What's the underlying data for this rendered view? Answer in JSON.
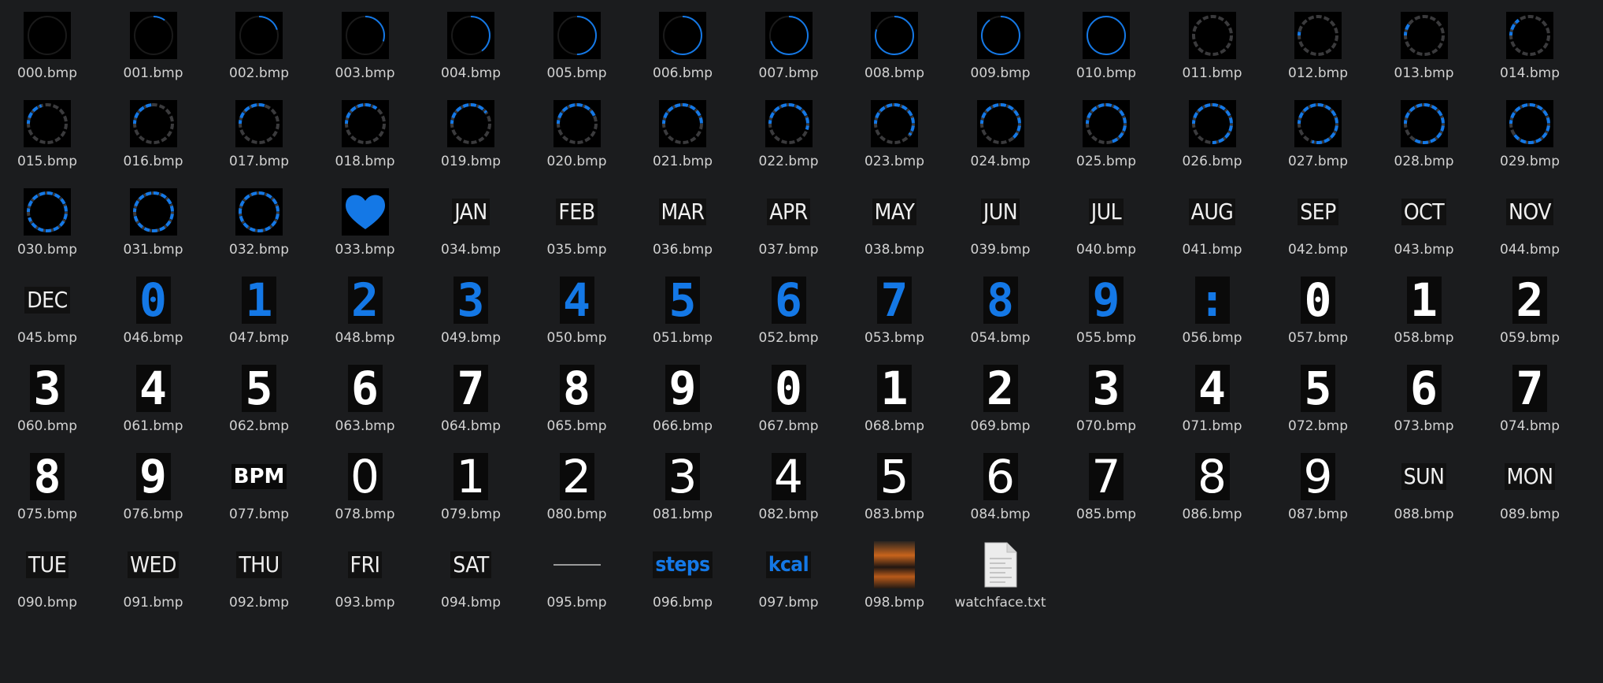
{
  "colors": {
    "background": "#1b1c1e",
    "label_text": "#d2d2d2",
    "accent_blue": "#1478e6",
    "ring_grey": "#3a3a3c",
    "thumb_black": "#0a0a0a"
  },
  "files": [
    {
      "name": "000.bmp",
      "kind": "ring",
      "style": "thin",
      "progress": 0
    },
    {
      "name": "001.bmp",
      "kind": "ring",
      "style": "thin",
      "progress": 0.1
    },
    {
      "name": "002.bmp",
      "kind": "ring",
      "style": "thin",
      "progress": 0.2
    },
    {
      "name": "003.bmp",
      "kind": "ring",
      "style": "thin",
      "progress": 0.3
    },
    {
      "name": "004.bmp",
      "kind": "ring",
      "style": "thin",
      "progress": 0.4
    },
    {
      "name": "005.bmp",
      "kind": "ring",
      "style": "thin",
      "progress": 0.5
    },
    {
      "name": "006.bmp",
      "kind": "ring",
      "style": "thin",
      "progress": 0.6
    },
    {
      "name": "007.bmp",
      "kind": "ring",
      "style": "thin",
      "progress": 0.7
    },
    {
      "name": "008.bmp",
      "kind": "ring",
      "style": "thin",
      "progress": 0.8
    },
    {
      "name": "009.bmp",
      "kind": "ring",
      "style": "thin",
      "progress": 0.9
    },
    {
      "name": "010.bmp",
      "kind": "ring",
      "style": "thin",
      "progress": 1
    },
    {
      "name": "011.bmp",
      "kind": "ring",
      "style": "dashed",
      "progress": 0
    },
    {
      "name": "012.bmp",
      "kind": "ring",
      "style": "dashed",
      "progress": 0.05
    },
    {
      "name": "013.bmp",
      "kind": "ring",
      "style": "dashed",
      "progress": 0.1
    },
    {
      "name": "014.bmp",
      "kind": "ring",
      "style": "dashed",
      "progress": 0.15
    },
    {
      "name": "015.bmp",
      "kind": "ring",
      "style": "dashed",
      "progress": 0.2
    },
    {
      "name": "016.bmp",
      "kind": "ring",
      "style": "dashed",
      "progress": 0.25
    },
    {
      "name": "017.bmp",
      "kind": "ring",
      "style": "dashed",
      "progress": 0.3
    },
    {
      "name": "018.bmp",
      "kind": "ring",
      "style": "dashed",
      "progress": 0.35
    },
    {
      "name": "019.bmp",
      "kind": "ring",
      "style": "dashed",
      "progress": 0.4
    },
    {
      "name": "020.bmp",
      "kind": "ring",
      "style": "dashed",
      "progress": 0.45
    },
    {
      "name": "021.bmp",
      "kind": "ring",
      "style": "dashed",
      "progress": 0.5
    },
    {
      "name": "022.bmp",
      "kind": "ring",
      "style": "dashed",
      "progress": 0.55
    },
    {
      "name": "023.bmp",
      "kind": "ring",
      "style": "dashed",
      "progress": 0.6
    },
    {
      "name": "024.bmp",
      "kind": "ring",
      "style": "dashed",
      "progress": 0.65
    },
    {
      "name": "025.bmp",
      "kind": "ring",
      "style": "dashed",
      "progress": 0.7
    },
    {
      "name": "026.bmp",
      "kind": "ring",
      "style": "dashed",
      "progress": 0.75
    },
    {
      "name": "027.bmp",
      "kind": "ring",
      "style": "dashed",
      "progress": 0.8
    },
    {
      "name": "028.bmp",
      "kind": "ring",
      "style": "dashed",
      "progress": 0.85
    },
    {
      "name": "029.bmp",
      "kind": "ring",
      "style": "dashed",
      "progress": 0.9
    },
    {
      "name": "030.bmp",
      "kind": "ring",
      "style": "dashed",
      "progress": 0.95
    },
    {
      "name": "031.bmp",
      "kind": "ring",
      "style": "dashed",
      "progress": 0.97
    },
    {
      "name": "032.bmp",
      "kind": "ring",
      "style": "dashed",
      "progress": 1
    },
    {
      "name": "033.bmp",
      "kind": "heart"
    },
    {
      "name": "034.bmp",
      "kind": "word",
      "text": "JAN"
    },
    {
      "name": "035.bmp",
      "kind": "word",
      "text": "FEB"
    },
    {
      "name": "036.bmp",
      "kind": "word",
      "text": "MAR"
    },
    {
      "name": "037.bmp",
      "kind": "word",
      "text": "APR"
    },
    {
      "name": "038.bmp",
      "kind": "word",
      "text": "MAY"
    },
    {
      "name": "039.bmp",
      "kind": "word",
      "text": "JUN"
    },
    {
      "name": "040.bmp",
      "kind": "word",
      "text": "JUL"
    },
    {
      "name": "041.bmp",
      "kind": "word",
      "text": "AUG"
    },
    {
      "name": "042.bmp",
      "kind": "word",
      "text": "SEP"
    },
    {
      "name": "043.bmp",
      "kind": "word",
      "text": "OCT"
    },
    {
      "name": "044.bmp",
      "kind": "word",
      "text": "NOV"
    },
    {
      "name": "045.bmp",
      "kind": "word",
      "text": "DEC"
    },
    {
      "name": "046.bmp",
      "kind": "digit",
      "style": "blue",
      "text": "0"
    },
    {
      "name": "047.bmp",
      "kind": "digit",
      "style": "blue",
      "text": "1"
    },
    {
      "name": "048.bmp",
      "kind": "digit",
      "style": "blue",
      "text": "2"
    },
    {
      "name": "049.bmp",
      "kind": "digit",
      "style": "blue",
      "text": "3"
    },
    {
      "name": "050.bmp",
      "kind": "digit",
      "style": "blue",
      "text": "4"
    },
    {
      "name": "051.bmp",
      "kind": "digit",
      "style": "blue",
      "text": "5"
    },
    {
      "name": "052.bmp",
      "kind": "digit",
      "style": "blue",
      "text": "6"
    },
    {
      "name": "053.bmp",
      "kind": "digit",
      "style": "blue",
      "text": "7"
    },
    {
      "name": "054.bmp",
      "kind": "digit",
      "style": "blue",
      "text": "8"
    },
    {
      "name": "055.bmp",
      "kind": "digit",
      "style": "blue",
      "text": "9"
    },
    {
      "name": "056.bmp",
      "kind": "digit",
      "style": "blue",
      "text": ":"
    },
    {
      "name": "057.bmp",
      "kind": "digit",
      "style": "bold",
      "text": "0"
    },
    {
      "name": "058.bmp",
      "kind": "digit",
      "style": "bold",
      "text": "1"
    },
    {
      "name": "059.bmp",
      "kind": "digit",
      "style": "bold",
      "text": "2"
    },
    {
      "name": "060.bmp",
      "kind": "digit",
      "style": "bold",
      "text": "3"
    },
    {
      "name": "061.bmp",
      "kind": "digit",
      "style": "bold",
      "text": "4"
    },
    {
      "name": "062.bmp",
      "kind": "digit",
      "style": "bold",
      "text": "5"
    },
    {
      "name": "063.bmp",
      "kind": "digit",
      "style": "bold",
      "text": "6"
    },
    {
      "name": "064.bmp",
      "kind": "digit",
      "style": "bold",
      "text": "7"
    },
    {
      "name": "065.bmp",
      "kind": "digit",
      "style": "bold",
      "text": "8"
    },
    {
      "name": "066.bmp",
      "kind": "digit",
      "style": "bold",
      "text": "9"
    },
    {
      "name": "067.bmp",
      "kind": "digit",
      "style": "bold",
      "text": "0"
    },
    {
      "name": "068.bmp",
      "kind": "digit",
      "style": "bold",
      "text": "1"
    },
    {
      "name": "069.bmp",
      "kind": "digit",
      "style": "bold",
      "text": "2"
    },
    {
      "name": "070.bmp",
      "kind": "digit",
      "style": "bold",
      "text": "3"
    },
    {
      "name": "071.bmp",
      "kind": "digit",
      "style": "bold",
      "text": "4"
    },
    {
      "name": "072.bmp",
      "kind": "digit",
      "style": "bold",
      "text": "5"
    },
    {
      "name": "073.bmp",
      "kind": "digit",
      "style": "bold",
      "text": "6"
    },
    {
      "name": "074.bmp",
      "kind": "digit",
      "style": "bold",
      "text": "7"
    },
    {
      "name": "075.bmp",
      "kind": "digit",
      "style": "bold",
      "text": "8"
    },
    {
      "name": "076.bmp",
      "kind": "digit",
      "style": "bold",
      "text": "9"
    },
    {
      "name": "077.bmp",
      "kind": "bpm",
      "text": "BPM"
    },
    {
      "name": "078.bmp",
      "kind": "digit",
      "style": "thin",
      "text": "0"
    },
    {
      "name": "079.bmp",
      "kind": "digit",
      "style": "thin",
      "text": "1"
    },
    {
      "name": "080.bmp",
      "kind": "digit",
      "style": "thin",
      "text": "2"
    },
    {
      "name": "081.bmp",
      "kind": "digit",
      "style": "thin",
      "text": "3"
    },
    {
      "name": "082.bmp",
      "kind": "digit",
      "style": "thin",
      "text": "4"
    },
    {
      "name": "083.bmp",
      "kind": "digit",
      "style": "thin",
      "text": "5"
    },
    {
      "name": "084.bmp",
      "kind": "digit",
      "style": "thin",
      "text": "6"
    },
    {
      "name": "085.bmp",
      "kind": "digit",
      "style": "thin",
      "text": "7"
    },
    {
      "name": "086.bmp",
      "kind": "digit",
      "style": "thin",
      "text": "8"
    },
    {
      "name": "087.bmp",
      "kind": "digit",
      "style": "thin",
      "text": "9"
    },
    {
      "name": "088.bmp",
      "kind": "word",
      "text": "SUN"
    },
    {
      "name": "089.bmp",
      "kind": "word",
      "text": "MON"
    },
    {
      "name": "090.bmp",
      "kind": "word",
      "text": "TUE"
    },
    {
      "name": "091.bmp",
      "kind": "word",
      "text": "WED"
    },
    {
      "name": "092.bmp",
      "kind": "word",
      "text": "THU"
    },
    {
      "name": "093.bmp",
      "kind": "word",
      "text": "FRI"
    },
    {
      "name": "094.bmp",
      "kind": "word",
      "text": "SAT"
    },
    {
      "name": "095.bmp",
      "kind": "line"
    },
    {
      "name": "096.bmp",
      "kind": "word",
      "style": "blue",
      "text": "steps"
    },
    {
      "name": "097.bmp",
      "kind": "word",
      "style": "blue",
      "text": "kcal"
    },
    {
      "name": "098.bmp",
      "kind": "photo"
    },
    {
      "name": "watchface.txt",
      "kind": "textfile"
    }
  ]
}
